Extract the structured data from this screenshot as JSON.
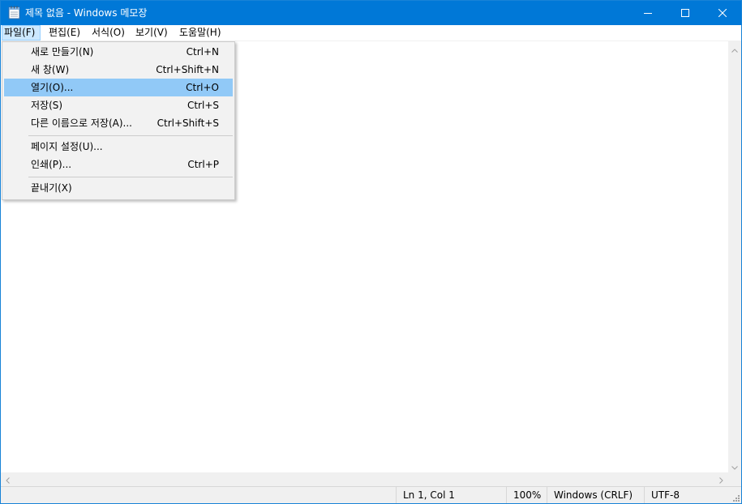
{
  "window": {
    "title": "제목 없음 - Windows 메모장",
    "icon": "notepad-icon"
  },
  "caption_buttons": {
    "minimize": "minimize-icon",
    "maximize": "maximize-icon",
    "close": "close-icon"
  },
  "menubar": {
    "items": [
      {
        "label": "파일(F)",
        "active": true
      },
      {
        "label": "편집(E)"
      },
      {
        "label": "서식(O)"
      },
      {
        "label": "보기(V)"
      },
      {
        "label": "도움말(H)"
      }
    ]
  },
  "file_menu": {
    "items": [
      {
        "label": "새로 만들기(N)",
        "shortcut": "Ctrl+N"
      },
      {
        "label": "새 창(W)",
        "shortcut": "Ctrl+Shift+N"
      },
      {
        "label": "열기(O)...",
        "shortcut": "Ctrl+O",
        "highlighted": true
      },
      {
        "label": "저장(S)",
        "shortcut": "Ctrl+S"
      },
      {
        "label": "다른 이름으로 저장(A)...",
        "shortcut": "Ctrl+Shift+S"
      },
      {
        "label": "페이지 설정(U)...",
        "shortcut": ""
      },
      {
        "label": "인쇄(P)...",
        "shortcut": "Ctrl+P"
      },
      {
        "label": "끝내기(X)",
        "shortcut": ""
      }
    ]
  },
  "statusbar": {
    "position": "Ln 1, Col 1",
    "zoom": "100%",
    "line_ending": "Windows (CRLF)",
    "encoding": "UTF-8"
  },
  "colors": {
    "titlebar": "#0078d7",
    "menu_highlight": "#91c9f7",
    "menubar_active": "#cce8ff"
  }
}
